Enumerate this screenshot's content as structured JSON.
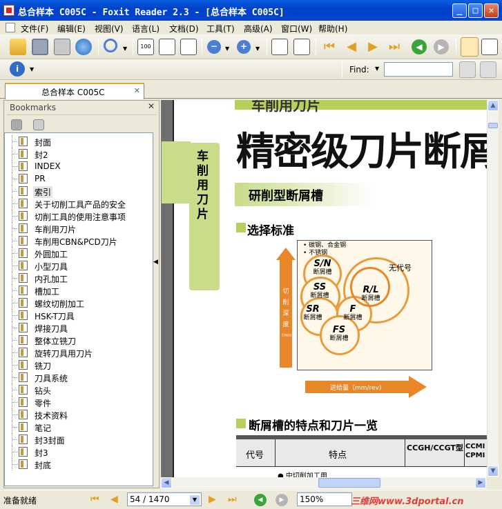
{
  "window": {
    "title": "总合样本 C005C - Foxit Reader 2.3 - [总合样本 C005C]",
    "min": "_",
    "max": "□",
    "close": "✕"
  },
  "menu": [
    "文件(F)",
    "编辑(E)",
    "视图(V)",
    "语言(L)",
    "文档(D)",
    "工具(T)",
    "高级(A)",
    "窗口(W)",
    "帮助(H)"
  ],
  "find": {
    "label": "Find:",
    "value": ""
  },
  "tab": {
    "label": "总合样本 C005C",
    "close": "✕"
  },
  "bookmarks": {
    "title": "Bookmarks",
    "close": "✕",
    "items": [
      "封面",
      "封2",
      "INDEX",
      "PR",
      "索引",
      "关于切削工具产品的安全",
      "切削工具的使用注意事项",
      "车削用刀片",
      "车削用CBN&PCD刀片",
      "外圆加工",
      "小型刀具",
      "内孔加工",
      "槽加工",
      "螺纹切削加工",
      "HSK-T刀具",
      "焊接刀具",
      "整体立铣刀",
      "旋转刀具用刀片",
      "铣刀",
      "刀具系统",
      "钻头",
      "零件",
      "技术资料",
      "笔记",
      "封3封面",
      "封3",
      "封底"
    ],
    "selected_index": 4
  },
  "page": {
    "header_strip": "车削用刀片",
    "side_tab": "车削用刀片",
    "big_title": "精密级刀片断屑",
    "subtitle": "研削型断屑槽",
    "section1": "选择标准",
    "chart_notes": [
      "• 碳钢、合金钢",
      "• 不锈钢"
    ],
    "y_axis": [
      "切",
      "削",
      "深",
      "度",
      "(mm)"
    ],
    "x_axis": "进给量（mm/rev)",
    "circles": [
      {
        "code": "S/N",
        "name": "断屑槽"
      },
      {
        "code": "SS",
        "name": "断屑槽"
      },
      {
        "code": "SR",
        "name": "断屑槽"
      },
      {
        "code": "FS",
        "name": "断屑槽"
      },
      {
        "code": "F",
        "name": "断屑槽"
      },
      {
        "code": "R/L",
        "name": "断屑槽"
      }
    ],
    "none_label": "无代号",
    "section2": "断屑槽的特点和刀片一览",
    "table_headers": [
      "代号",
      "特点",
      "CCGH/CCGT型",
      "CCMI CPMI"
    ],
    "table_first_row": "● 中切削加工用"
  },
  "status": {
    "text": "准备就绪",
    "page_current": "54 / 1470",
    "zoom": "150%",
    "watermark": "三维网www.3dportal.cn"
  },
  "colors": {
    "accent_green": "#B6D05A",
    "side_tab": "#C8DC8A",
    "orange": "#E8862A",
    "titlebar": "#0A5FE0"
  }
}
